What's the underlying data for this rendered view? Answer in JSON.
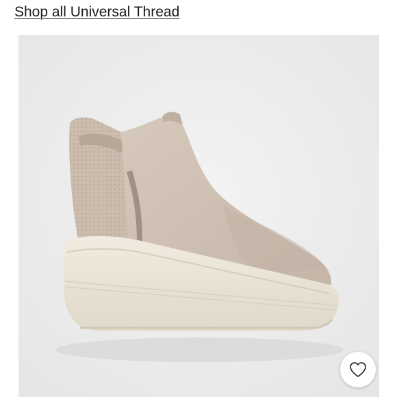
{
  "header": {
    "shop_link_label": "Shop all Universal Thread"
  },
  "product": {
    "image_subject": "tan suede slip-on high-top sneaker on cream platform sole",
    "colors": {
      "upper": "#cdbfb2",
      "upper_shadow": "#b9aa9c",
      "sole": "#ece6d8",
      "background": "#efefef"
    }
  },
  "actions": {
    "like_icon": "heart-outline-icon"
  }
}
